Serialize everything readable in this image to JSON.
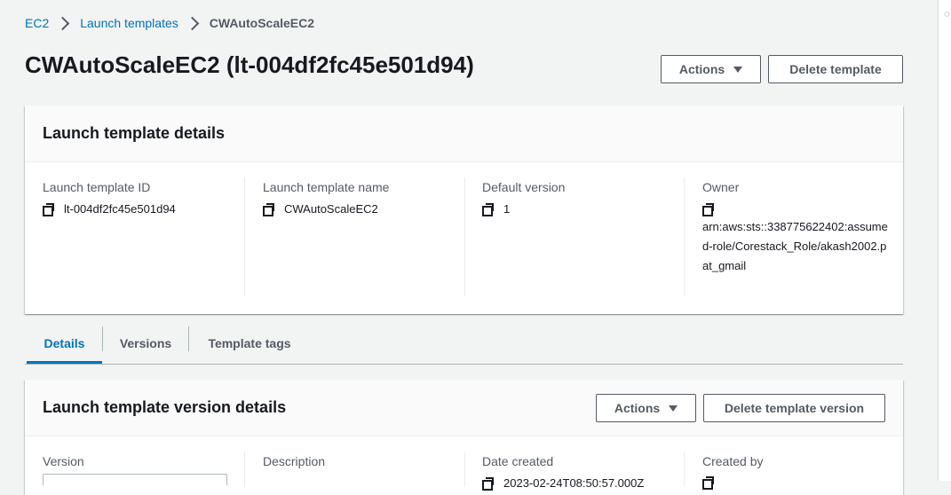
{
  "breadcrumb": {
    "items": [
      "EC2",
      "Launch templates"
    ],
    "current": "CWAutoScaleEC2"
  },
  "page": {
    "title": "CWAutoScaleEC2 (lt-004df2fc45e501d94)",
    "actions_label": "Actions",
    "delete_label": "Delete template"
  },
  "details": {
    "title": "Launch template details",
    "fields": [
      {
        "label": "Launch template ID",
        "value": "lt-004df2fc45e501d94"
      },
      {
        "label": "Launch template name",
        "value": "CWAutoScaleEC2"
      },
      {
        "label": "Default version",
        "value": "1"
      },
      {
        "label": "Owner",
        "value": "arn:aws:sts::338775622402:assumed-role/Corestack_Role/akash2002.pat_gmail"
      }
    ]
  },
  "tabs": [
    {
      "label": "Details",
      "active": true
    },
    {
      "label": "Versions",
      "active": false
    },
    {
      "label": "Template tags",
      "active": false
    }
  ],
  "version_details": {
    "title": "Launch template version details",
    "actions_label": "Actions",
    "delete_label": "Delete template version",
    "fields": [
      {
        "label": "Version"
      },
      {
        "label": "Description"
      },
      {
        "label": "Date created",
        "value": "2023-02-24T08:50:57.000Z"
      },
      {
        "label": "Created by"
      }
    ]
  },
  "colors": {
    "link": "#0073bb",
    "text": "#16191f",
    "secondary": "#545b64",
    "background": "#f2f3f3"
  }
}
